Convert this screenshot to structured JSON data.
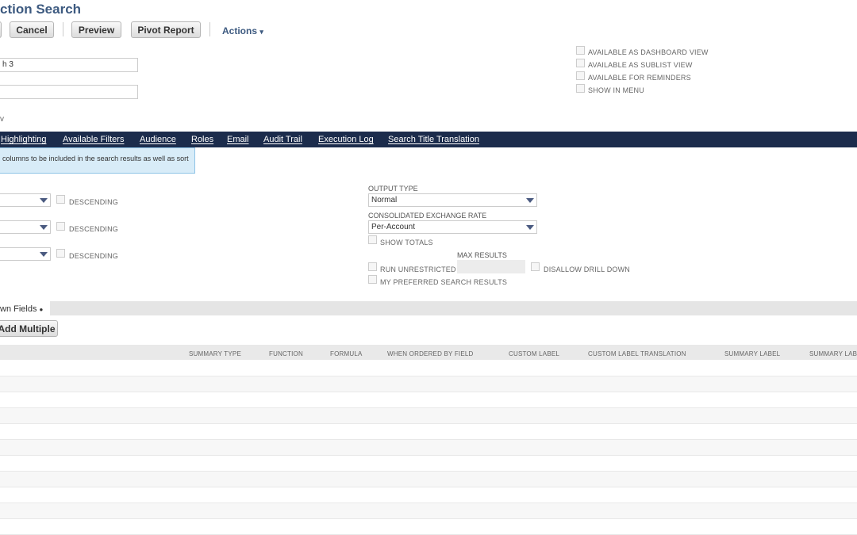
{
  "page": {
    "title": "ction Search"
  },
  "toolbar": {
    "cancel_label": "Cancel",
    "preview_label": "Preview",
    "pivot_label": "Pivot Report",
    "actions_label": "Actions",
    "actions_caret": "▾"
  },
  "form": {
    "name_value": "h 3",
    "id_value": "",
    "partial_label": "v"
  },
  "options": {
    "dashboard": "AVAILABLE AS DASHBOARD VIEW",
    "sublist": "AVAILABLE AS SUBLIST VIEW",
    "reminders": "AVAILABLE FOR REMINDERS",
    "menu": "SHOW IN MENU"
  },
  "tabs": [
    "Highlighting",
    "Available Filters",
    "Audience",
    "Roles",
    "Email",
    "Audit Trail",
    "Execution Log",
    "Search Title Translation"
  ],
  "help": {
    "text": "columns to be included in the search results as well as sort"
  },
  "sort": {
    "descending_1": "DESCENDING",
    "descending_2": "DESCENDING",
    "descending_3": "DESCENDING"
  },
  "output": {
    "output_type_label": "OUTPUT TYPE",
    "output_type_value": "Normal",
    "exchange_rate_label": "CONSOLIDATED EXCHANGE RATE",
    "exchange_rate_value": "Per-Account",
    "show_totals": "SHOW TOTALS",
    "max_results_label": "MAX RESULTS",
    "run_unrestricted": "RUN UNRESTRICTED",
    "disallow_drill": "DISALLOW DRILL DOWN",
    "preferred": "MY PREFERRED SEARCH RESULTS"
  },
  "results": {
    "subtab_label": "wn Fields",
    "subtab_dot": "●",
    "add_multiple": "Add Multiple",
    "columns": [
      "SUMMARY TYPE",
      "FUNCTION",
      "FORMULA",
      "WHEN ORDERED BY FIELD",
      "CUSTOM LABEL",
      "CUSTOM LABEL TRANSLATION",
      "SUMMARY LABEL",
      "SUMMARY LABI"
    ]
  }
}
